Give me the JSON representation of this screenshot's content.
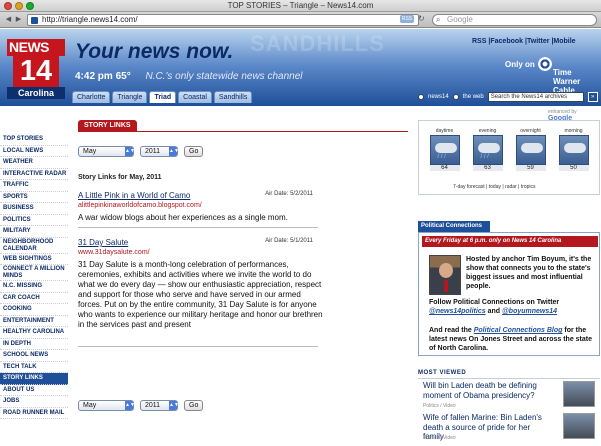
{
  "browser": {
    "window_title": "TOP STORIES – Triangle – News14.com",
    "url": "http://triangle.news14.com/",
    "rss_badge": "RSS",
    "search_placeholder": "Google"
  },
  "banner": {
    "faint_text": "SANDHILLS",
    "logo_news": "NEWS",
    "logo_number": "14",
    "logo_region": "Carolina",
    "tagline": "Your news now.",
    "time": "4:42 pm 65°",
    "subtitle": "N.C.'s only statewide news channel",
    "top_links": [
      "RSS",
      "|Facebook",
      "|Twitter",
      "|Mobile"
    ],
    "only_on": "Only on",
    "sponsor": "Time Warner Cable",
    "tabs": [
      "Charlotte",
      "Triangle",
      "Triad",
      "Coastal",
      "Sandhills"
    ],
    "active_tab": "Triad",
    "search_news14": "news14",
    "search_web": "the web",
    "search_placeholder": "Search the News14 archives",
    "search_go": "»",
    "enhanced_by": "enhanced by",
    "google": "Google"
  },
  "sidebar": {
    "items": [
      "TOP STORIES",
      "LOCAL NEWS",
      "WEATHER",
      "INTERACTIVE RADAR",
      "TRAFFIC",
      "SPORTS",
      "BUSINESS",
      "POLITICS",
      "MILITARY",
      "NEIGHBORHOOD CALENDAR",
      "WEB SIGHTINGS",
      "CONNECT A MILLION MINDS",
      "N.C. MISSING",
      "CAR COACH",
      "COOKING",
      "ENTERTAINMENT",
      "HEALTHY CAROLINA",
      "IN DEPTH",
      "SCHOOL NEWS",
      "TECH TALK",
      "STORY LINKS",
      "ABOUT US",
      "JOBS",
      "ROAD RUNNER MAIL"
    ],
    "active": "STORY LINKS"
  },
  "main": {
    "section_title": "STORY LINKS",
    "month": "May",
    "year": "2011",
    "go_label": "Go",
    "heading": "Story Links for May, 2011",
    "stories": [
      {
        "title": "A Little Pink in a World of Camo",
        "air_date": "Air Date: 5/2/2011",
        "url": "alittlepinkinaworldofcamo.blogspot.com/",
        "desc": "A war widow blogs about her experiences as a single mom."
      },
      {
        "title": "31 Day Salute",
        "air_date": "Air Date: 5/1/2011",
        "url": "www.31daysalute.com/",
        "desc": "31 Day Salute is a month-long celebration of performances, ceremonies, exhibits and activities where we invite the world to do what we do every day — show our enthusiastic appreciation, respect and support for those who serve and have served in our armed forces. Put on by the entire community, 31 Day Salute is for anyone who wants to experience our military heritage and honor our brethren in the services past and present"
      }
    ]
  },
  "weather": {
    "periods": [
      {
        "label": "daytime",
        "temp": "64"
      },
      {
        "label": "evening",
        "temp": "63"
      },
      {
        "label": "overnight",
        "temp": "59"
      },
      {
        "label": "morning",
        "temp": "50"
      }
    ],
    "links": "7-day forecast | today | radar | tropics"
  },
  "political": {
    "tab": "Political Connections",
    "schedule": "Every Friday at 6 p.m. only on News 14 Carolina",
    "p1": "Hosted by anchor Tim Boyum, it's the show that connects you to the state's biggest issues and most influential people.",
    "p2_pre": "Follow Political Connections on Twitter",
    "p2_link1": "@news14politics",
    "p2_and": " and ",
    "p2_link2": "@boyumnews14",
    "p3_pre": "And read the ",
    "p3_link": "Political Connections Blog",
    "p3_post": " for the latest news On Jones Street and across the state of North Carolina."
  },
  "most_viewed": {
    "heading": "MOST VIEWED",
    "items": [
      {
        "title": "Will bin Laden death be defining moment of Obama presidency?",
        "meta": "Politics / Video"
      },
      {
        "title": "Wife of fallen Marine: Bin Laden's death a source of pride for her family",
        "meta": "Politics / Video"
      }
    ]
  }
}
